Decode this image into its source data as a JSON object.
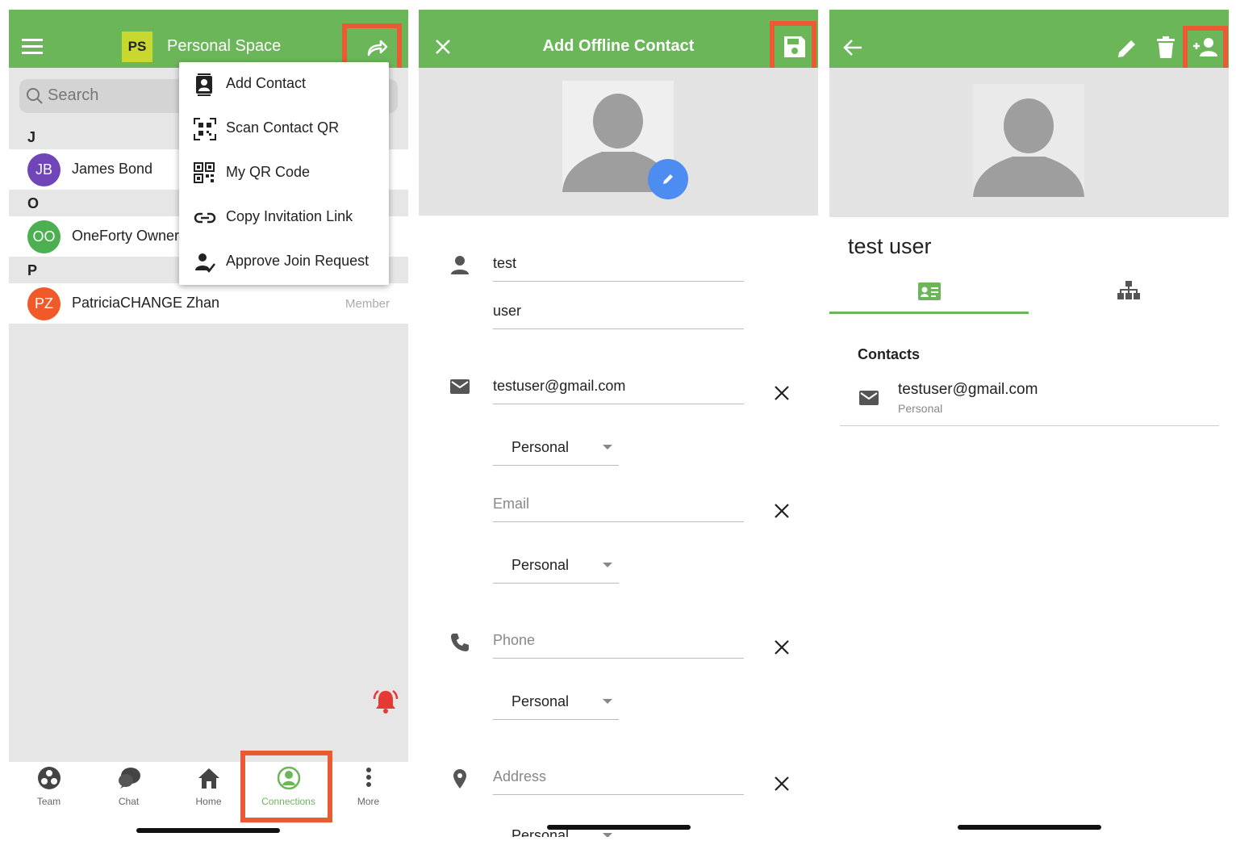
{
  "colors": {
    "app_green": "#6cb65a",
    "highlight_red": "#ea5a33",
    "fab_blue": "#4d8cf0",
    "notify_red": "#e53935"
  },
  "screen1": {
    "space_badge": "PS",
    "space_title": "Personal Space",
    "search_placeholder": "Search",
    "menu": [
      {
        "label": "Add Contact",
        "icon": "contact-card-icon"
      },
      {
        "label": "Scan Contact QR",
        "icon": "qr-scan-icon"
      },
      {
        "label": "My QR Code",
        "icon": "qr-code-icon"
      },
      {
        "label": "Copy Invitation Link",
        "icon": "link-icon"
      },
      {
        "label": "Approve Join Request",
        "icon": "person-check-icon"
      }
    ],
    "sections": [
      "J",
      "O",
      "P"
    ],
    "contacts": [
      {
        "initials": "JB",
        "name": "James Bond",
        "role": "",
        "color": "#6f45b8"
      },
      {
        "initials": "OO",
        "name": "OneForty Owner",
        "role": "",
        "color": "#4caf50"
      },
      {
        "initials": "PZ",
        "name": "PatriciaCHANGE Zhan",
        "role": "Member",
        "color": "#f05a28"
      }
    ],
    "nav": [
      {
        "label": "Team",
        "icon": "team-icon"
      },
      {
        "label": "Chat",
        "icon": "chat-icon"
      },
      {
        "label": "Home",
        "icon": "home-icon"
      },
      {
        "label": "Connections",
        "icon": "connections-icon",
        "active": true
      },
      {
        "label": "More",
        "icon": "more-vertical-icon"
      }
    ]
  },
  "screen2": {
    "title": "Add Offline Contact",
    "first_name": "test",
    "last_name": "user",
    "email_value": "testuser@gmail.com",
    "email_type_1": "Personal",
    "email_placeholder": "Email",
    "email_type_2": "Personal",
    "phone_placeholder": "Phone",
    "phone_type": "Personal",
    "address_placeholder": "Address",
    "address_type": "Personal"
  },
  "screen3": {
    "name": "test user",
    "contacts_heading": "Contacts",
    "email": "testuser@gmail.com",
    "email_type": "Personal"
  }
}
